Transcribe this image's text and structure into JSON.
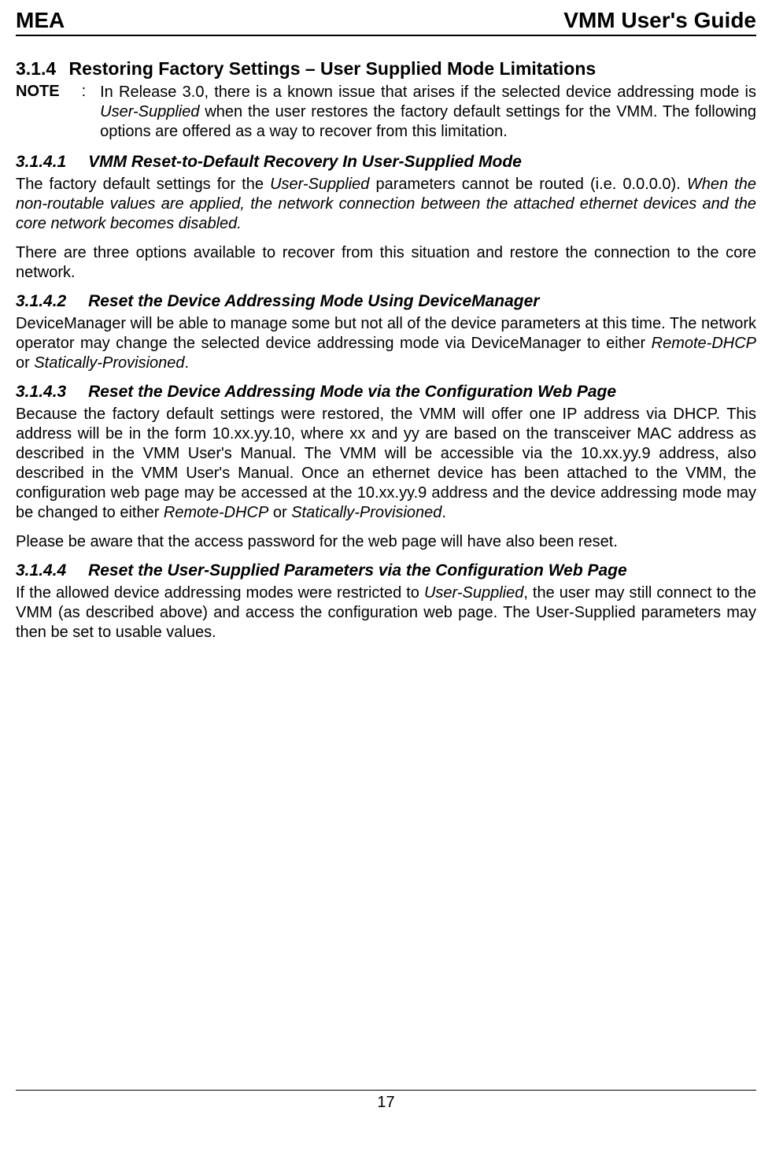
{
  "header": {
    "left": "MEA",
    "right": "VMM User's Guide"
  },
  "section": {
    "number": "3.1.4",
    "title": "Restoring Factory Settings – User Supplied Mode Limitations"
  },
  "note": {
    "label": "NOTE",
    "colon": ":",
    "text_pre": "In Release 3.0, there is a known issue that arises if the selected device addressing mode is ",
    "text_italic": "User-Supplied",
    "text_post": " when the user restores the factory default settings for the VMM.  The following options are offered as a way to recover from this limitation."
  },
  "sub1": {
    "number": "3.1.4.1",
    "title": "VMM Reset-to-Default Recovery In User-Supplied Mode",
    "p1_pre": "The factory default settings for the ",
    "p1_italic1": "User-Supplied",
    "p1_mid": " parameters cannot be routed (i.e. 0.0.0.0). ",
    "p1_italic2": "When the non-routable values are applied, the network connection between the attached ethernet devices and the core network becomes disabled.",
    "p2": "There are three options available to recover from this situation and restore the connection to the core network."
  },
  "sub2": {
    "number": "3.1.4.2",
    "title": "Reset the Device Addressing Mode Using DeviceManager",
    "p1_pre": "DeviceManager will be able to manage some but not all of the device parameters at this time. The network operator may change the selected device addressing mode via DeviceManager to either ",
    "p1_italic1": "Remote-DHCP",
    "p1_mid": " or ",
    "p1_italic2": "Statically-Provisioned",
    "p1_post": "."
  },
  "sub3": {
    "number": "3.1.4.3",
    "title": "Reset the Device Addressing Mode via the Configuration Web Page",
    "p1_pre": "Because the factory default settings were restored, the VMM will offer one IP address via DHCP. This address will be in the form 10.xx.yy.10, where xx and yy are based on the transceiver MAC address as described in the VMM User's Manual. The VMM will be accessible via the 10.xx.yy.9 address, also described in the VMM User's Manual. Once an ethernet device has been attached to the VMM, the configuration web page may be accessed at the 10.xx.yy.9 address and the device addressing mode may be changed to either ",
    "p1_italic1": "Remote-DHCP",
    "p1_mid": " or ",
    "p1_italic2": "Statically-Provisioned",
    "p1_post": ".",
    "p2": "Please be aware that the access password for the web page will have also been reset."
  },
  "sub4": {
    "number": "3.1.4.4",
    "title": "Reset the User-Supplied Parameters via the Configuration Web Page",
    "p1_pre": "If the allowed device addressing modes were restricted to ",
    "p1_italic": "User-Supplied",
    "p1_post": ", the user may still connect to the VMM (as described above) and access the configuration web page. The User-Supplied parameters may then be set to usable values."
  },
  "footer": {
    "page_number": "17"
  }
}
